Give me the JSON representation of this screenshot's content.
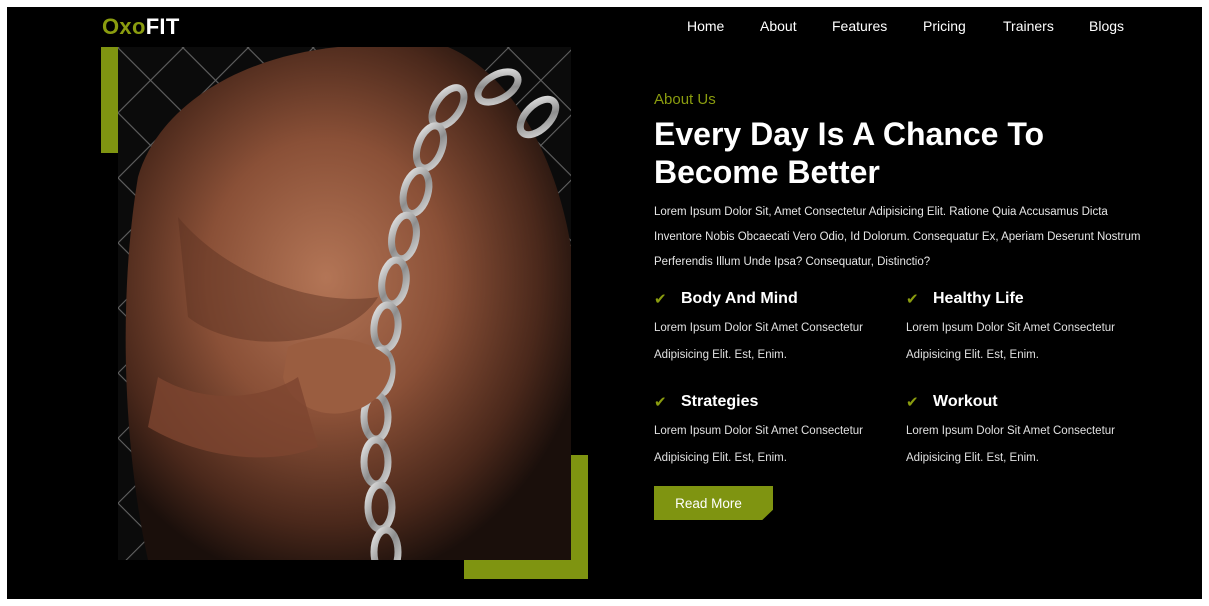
{
  "brand": {
    "prefix": "Oxo",
    "suffix": "FIT"
  },
  "nav": {
    "items": [
      {
        "label": "Home"
      },
      {
        "label": "About"
      },
      {
        "label": "Features"
      },
      {
        "label": "Pricing"
      },
      {
        "label": "Trainers"
      },
      {
        "label": "Blogs"
      }
    ]
  },
  "about": {
    "eyebrow": "About Us",
    "headline_line1": "Every Day Is A Chance To",
    "headline_line2": "Become Better",
    "intro": "Lorem Ipsum Dolor Sit, Amet Consectetur Adipisicing Elit. Ratione Quia Accusamus Dicta Inventore Nobis Obcaecati Vero Odio, Id Dolorum. Consequatur Ex, Aperiam Deserunt Nostrum Perferendis Illum Unde Ipsa? Consequatur, Distinctio?",
    "features": [
      {
        "title": "Body And Mind",
        "desc": "Lorem Ipsum Dolor Sit Amet Consectetur Adipisicing Elit. Est, Enim."
      },
      {
        "title": "Healthy Life",
        "desc": "Lorem Ipsum Dolor Sit Amet Consectetur Adipisicing Elit. Est, Enim."
      },
      {
        "title": "Strategies",
        "desc": "Lorem Ipsum Dolor Sit Amet Consectetur Adipisicing Elit. Est, Enim."
      },
      {
        "title": "Workout",
        "desc": "Lorem Ipsum Dolor Sit Amet Consectetur Adipisicing Elit. Est, Enim."
      }
    ],
    "check_icon": "✔",
    "cta_label": "Read More"
  },
  "colors": {
    "accent": "#8a9c0f",
    "background": "#000000",
    "text": "#ffffff"
  },
  "icons": {
    "feature": "check-icon"
  }
}
